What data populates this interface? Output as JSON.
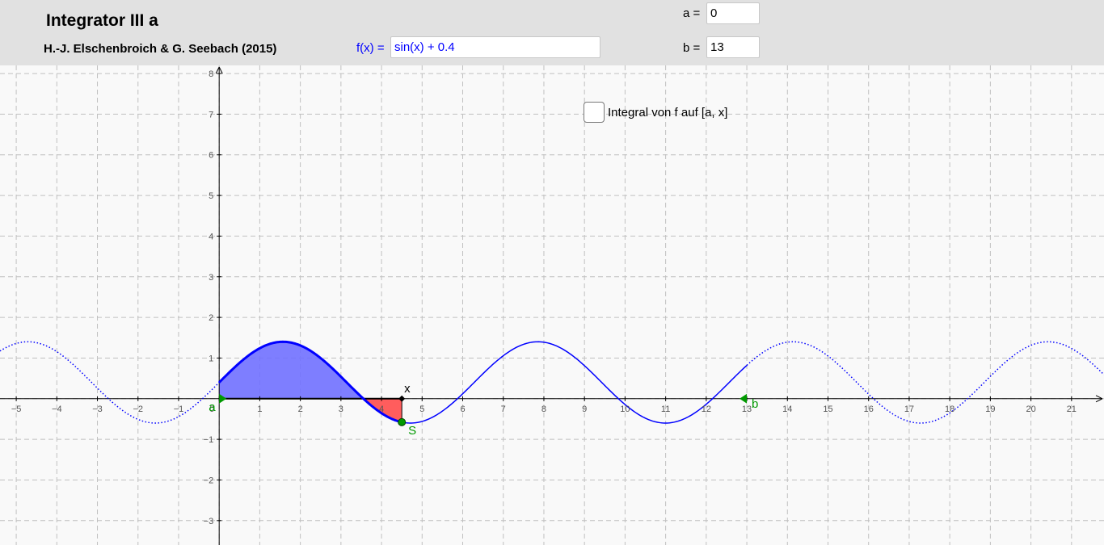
{
  "header": {
    "title": "Integrator III a",
    "authors": "H.-J. Elschenbroich & G. Seebach (2015)",
    "function_label": "f(x) =",
    "function_value": "sin(x) + 0.4",
    "a_label": "a =",
    "a_value": "0",
    "b_label": "b =",
    "b_value": "13"
  },
  "checkbox": {
    "label": "Integral von f auf [a, x]",
    "checked": false
  },
  "graph": {
    "x_ticks": [
      "−5",
      "−4",
      "−3",
      "−2",
      "−1",
      "0",
      "1",
      "2",
      "3",
      "4",
      "5",
      "6",
      "7",
      "8",
      "9",
      "10",
      "11",
      "12",
      "13",
      "14",
      "15",
      "16",
      "17",
      "18",
      "19",
      "20",
      "21"
    ],
    "y_ticks": [
      "8",
      "7",
      "6",
      "5",
      "4",
      "3",
      "2",
      "1",
      "−1",
      "−2",
      "−3"
    ],
    "x_range": [
      -5.4,
      21.8
    ],
    "y_range": [
      -3.6,
      8.2
    ],
    "grid": true,
    "point_x_label": "x",
    "point_s_label": "S",
    "marker_a_label": "a",
    "marker_b_label": "b",
    "x_value": 4.5,
    "a": 0,
    "b": 13,
    "colors": {
      "curve": "#0000ff",
      "positive_area": "#7070ff",
      "negative_area": "#ff4b4b",
      "markers": "#009900"
    }
  }
}
